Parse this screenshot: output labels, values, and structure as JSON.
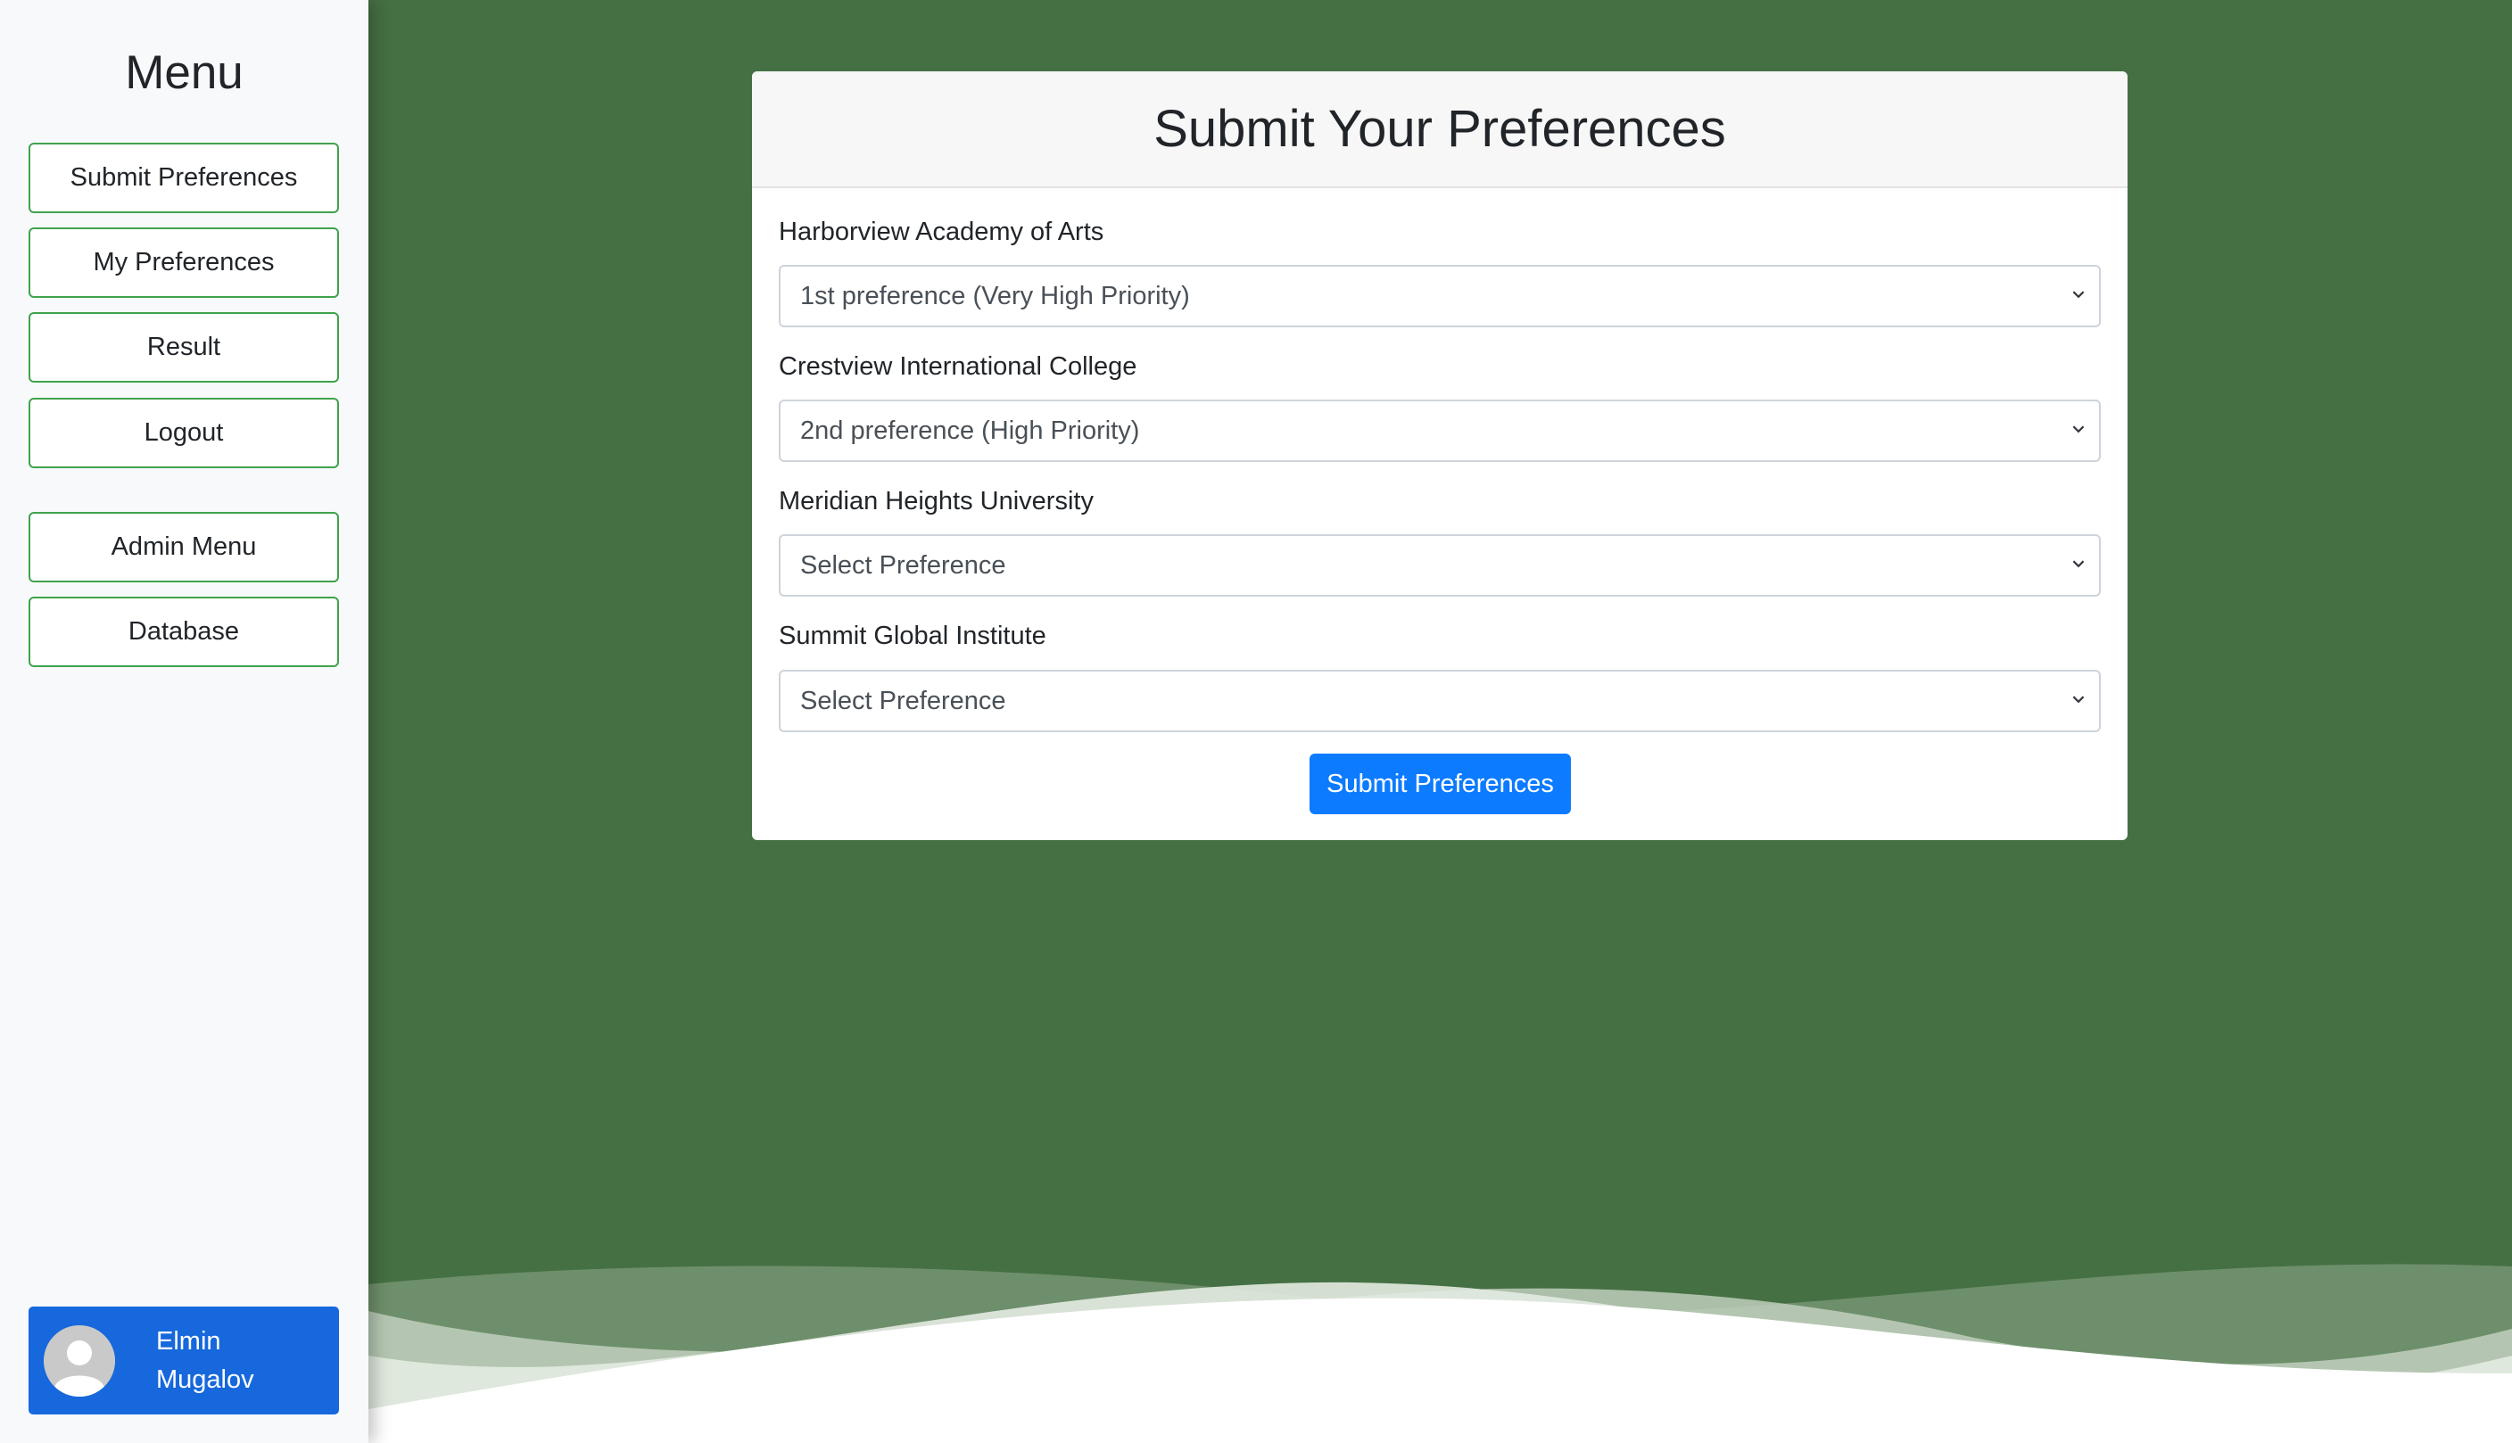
{
  "sidebar": {
    "title": "Menu",
    "items": [
      {
        "label": "Submit Preferences"
      },
      {
        "label": "My Preferences"
      },
      {
        "label": "Result"
      },
      {
        "label": "Logout"
      }
    ],
    "admin_items": [
      {
        "label": "Admin Menu"
      },
      {
        "label": "Database"
      }
    ],
    "user": {
      "first_name": "Elmin",
      "last_name": "Mugalov",
      "avatar_icon": "user-avatar-icon"
    }
  },
  "form": {
    "title": "Submit Your Preferences",
    "fields": [
      {
        "label": "Harborview Academy of Arts",
        "value": "1st preference (Very High Priority)"
      },
      {
        "label": "Crestview International College",
        "value": "2nd preference (High Priority)"
      },
      {
        "label": "Meridian Heights University",
        "value": "Select Preference"
      },
      {
        "label": "Summit Global Institute",
        "value": "Select Preference"
      }
    ],
    "submit_label": "Submit Preferences"
  },
  "colors": {
    "background": "#457043",
    "sidebar": "#f8f9fa",
    "nav_border": "#3fa34d",
    "primary": "#0d7bff",
    "user_card": "#1668dc"
  }
}
